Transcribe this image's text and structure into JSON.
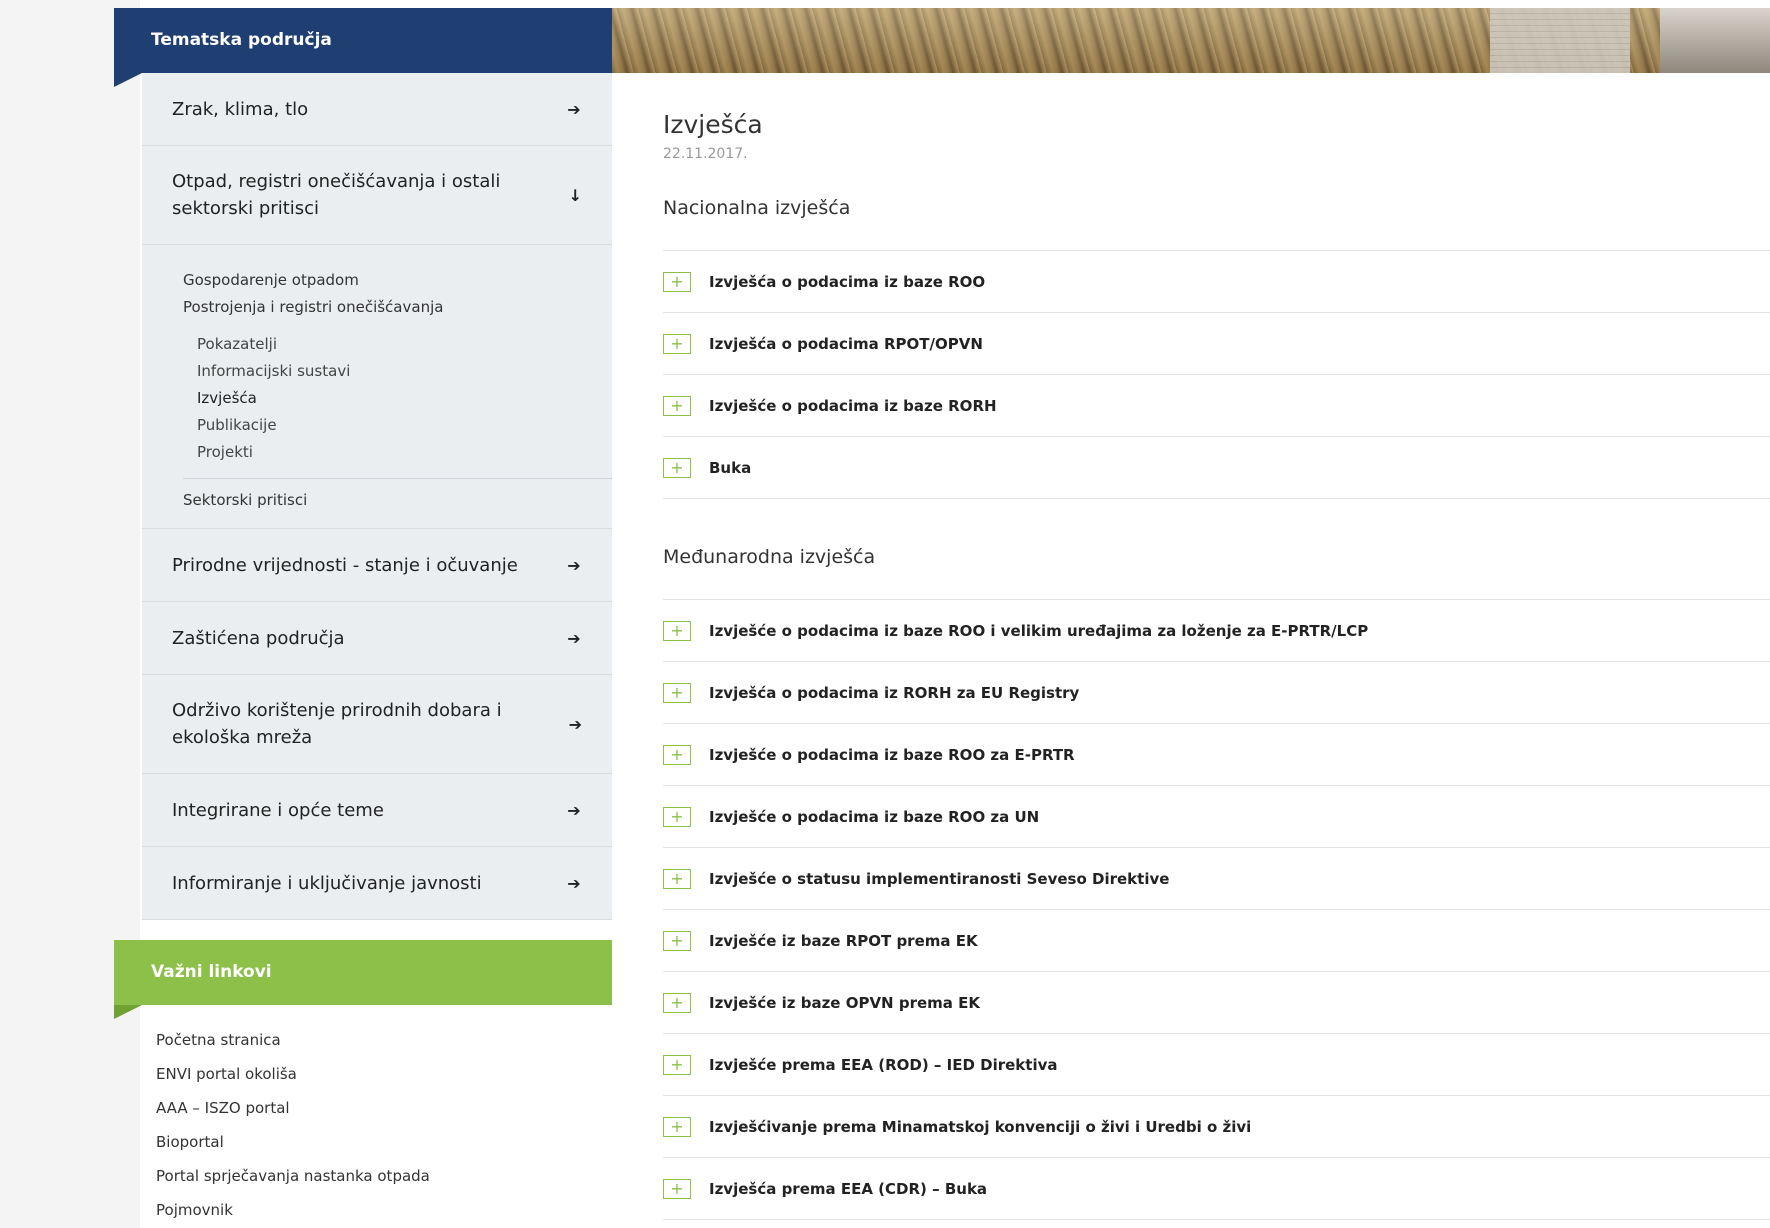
{
  "sidebar": {
    "header": "Tematska područja",
    "menu": [
      {
        "label": "Zrak, klima, tlo",
        "arrow": "➔"
      },
      {
        "label": "Otpad, registri onečišćavanja i ostali sektorski pritisci",
        "arrow": "↓"
      },
      {
        "label": "Prirodne vrijednosti - stanje i očuvanje",
        "arrow": "➔"
      },
      {
        "label": "Zaštićena područja",
        "arrow": "➔"
      },
      {
        "label": "Održivo korištenje prirodnih dobara i ekološka mreža",
        "arrow": "➔"
      },
      {
        "label": "Integrirane i opće teme",
        "arrow": "➔"
      },
      {
        "label": "Informiranje i uključivanje javnosti",
        "arrow": "➔"
      }
    ],
    "submenu": {
      "level1_top": [
        "Gospodarenje otpadom",
        "Postrojenja i registri onečišćavanja"
      ],
      "level2": [
        "Pokazatelji",
        "Informacijski sustavi",
        "Izvješća",
        "Publikacije",
        "Projekti"
      ],
      "level1_bottom": "Sektorski pritisci",
      "active": "Izvješća"
    },
    "links_header": "Važni linkovi",
    "links": [
      "Početna stranica",
      "ENVI portal okoliša",
      "AAA – ISZO portal",
      "Bioportal",
      "Portal sprječavanja nastanka otpada",
      "Pojmovnik"
    ]
  },
  "main": {
    "title": "Izvješća",
    "date": "22.11.2017.",
    "national": {
      "title": "Nacionalna izvješća",
      "items": [
        "Izvješća o podacima iz baze ROO",
        "Izvješća o podacima RPOT/OPVN",
        "Izvješće o podacima iz baze RORH",
        "Buka"
      ]
    },
    "international": {
      "title": "Međunarodna izvješća",
      "items": [
        "Izvješće o podacima iz baze ROO i velikim uređajima za loženje za E-PRTR/LCP",
        "Izvješća o podacima iz RORH za EU Registry",
        "Izvješće o podacima iz baze ROO za E-PRTR",
        "Izvješće o podacima iz baze ROO za UN",
        "Izvješće o statusu implementiranosti Seveso Direktive",
        "Izvješće iz baze RPOT prema EK",
        "Izvješće iz baze OPVN prema EK",
        "Izvješće prema EEA (ROD) – IED Direktiva",
        "Izvješćivanje prema Minamatskoj konvenciji o živi i Uredbi o živi",
        "Izvješća prema EEA (CDR) – Buka"
      ]
    },
    "expand_symbol": "+"
  },
  "colors": {
    "header_blue": "#1f3f73",
    "links_green": "#8cc049",
    "menu_bg": "#eaeef1"
  }
}
